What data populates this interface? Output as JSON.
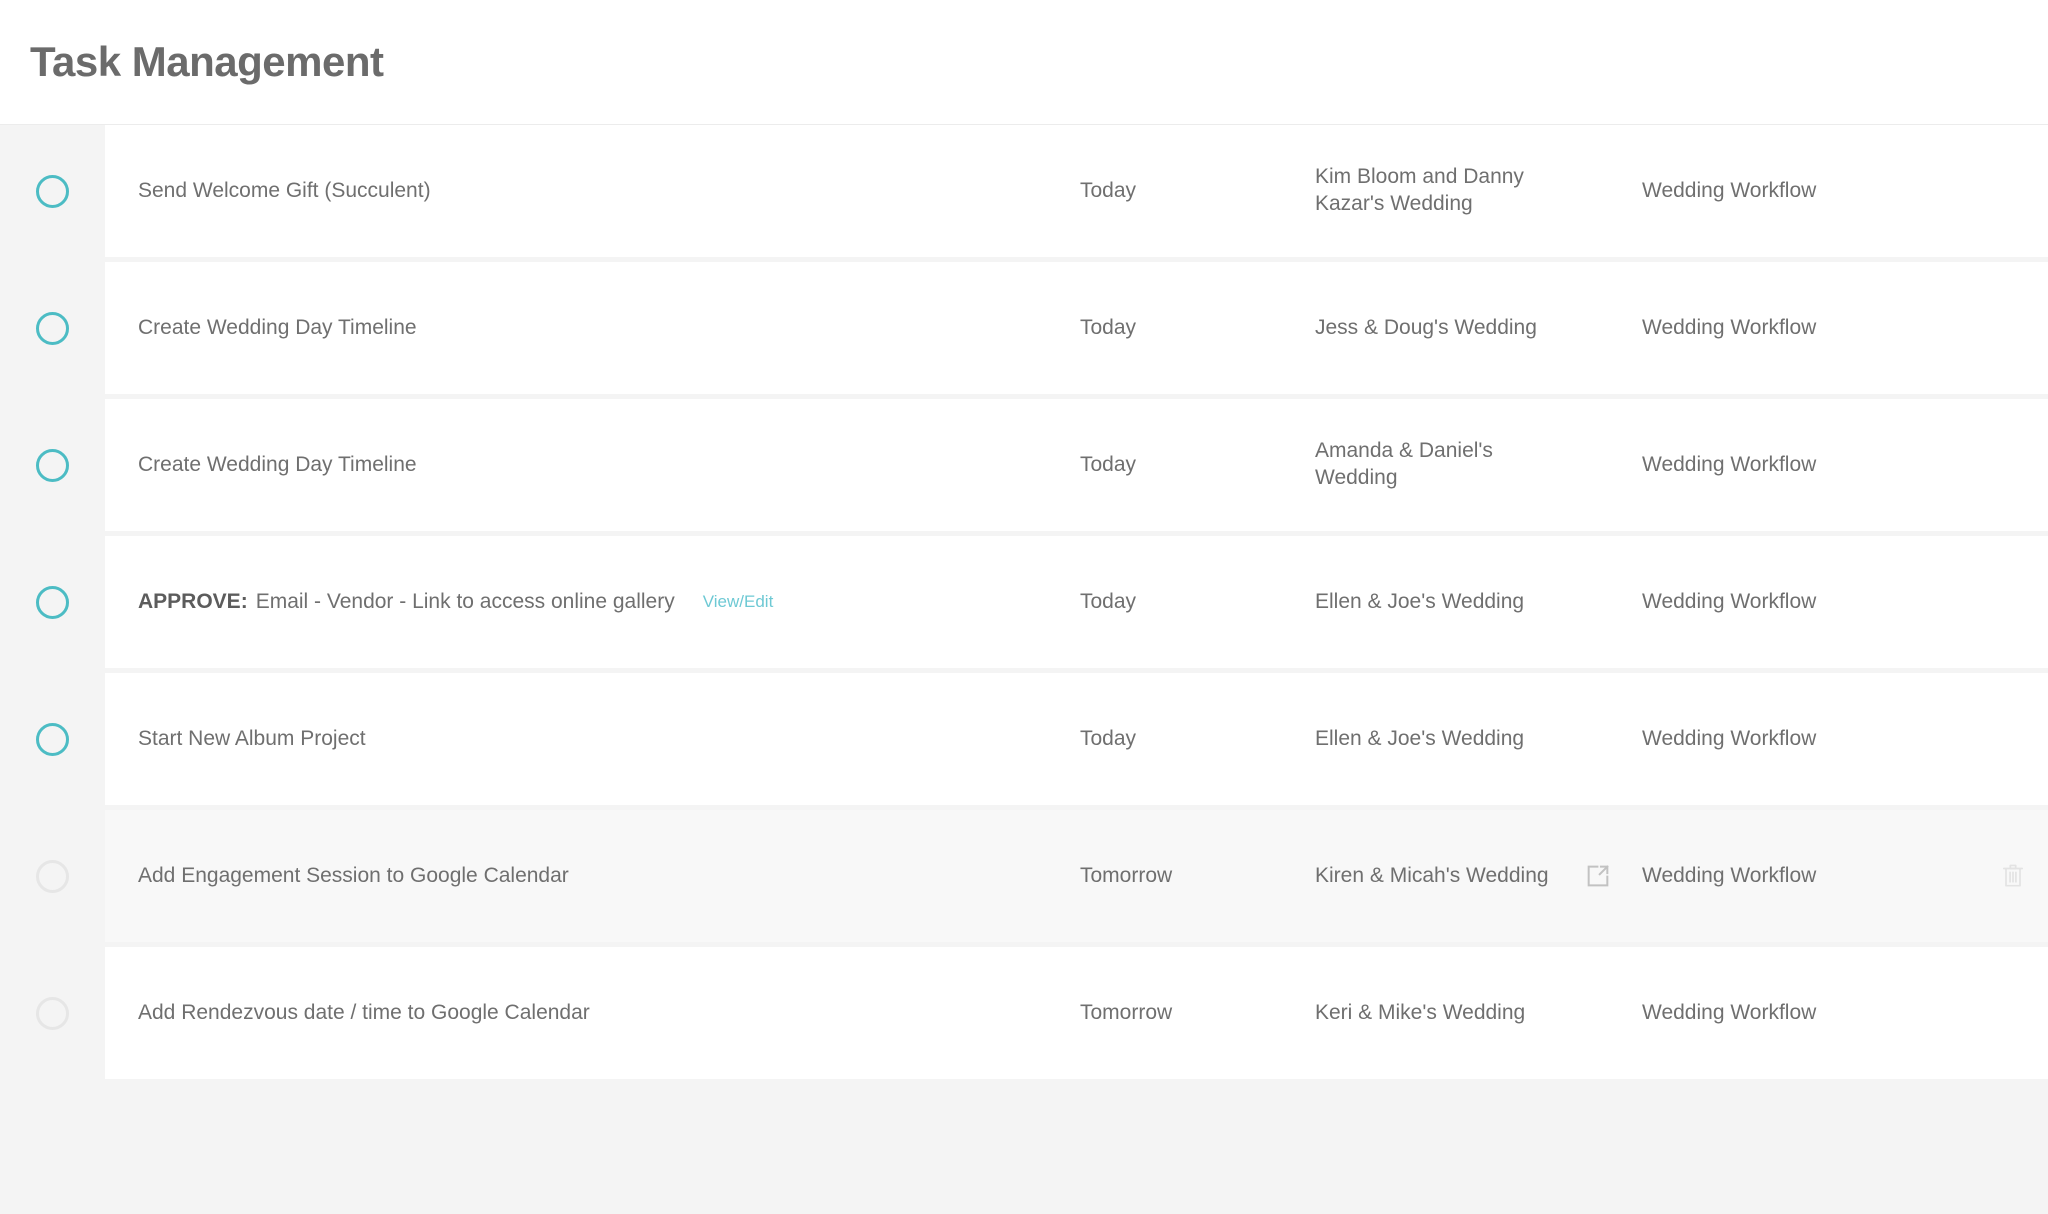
{
  "header": {
    "title": "Task Management"
  },
  "colors": {
    "accent_teal": "#4cbcc4",
    "link_teal": "#6ec9d4",
    "text_gray": "#6f6f6f",
    "title_gray": "#6b6b6b",
    "page_bg": "#f4f4f4",
    "card_bg": "#ffffff",
    "row_hover_bg": "#f8f8f8",
    "muted_circle": "#e6e6e6"
  },
  "icons": {
    "complete_toggle": "circle-outline-icon",
    "open_external": "external-link-icon",
    "delete": "trash-icon"
  },
  "tasks": [
    {
      "toggle_state": "active",
      "prefix": "",
      "label": "Send Welcome Gift (Succulent)",
      "link": "",
      "date": "Today",
      "client": "Kim Bloom and Danny Kazar's Wedding",
      "workflow": "Wedding Workflow",
      "hover": false,
      "show_icons": false
    },
    {
      "toggle_state": "active",
      "prefix": "",
      "label": "Create Wedding Day Timeline",
      "link": "",
      "date": "Today",
      "client": "Jess & Doug's Wedding",
      "workflow": "Wedding Workflow",
      "hover": false,
      "show_icons": false
    },
    {
      "toggle_state": "active",
      "prefix": "",
      "label": "Create Wedding Day Timeline",
      "link": "",
      "date": "Today",
      "client": "Amanda & Daniel's Wedding",
      "workflow": "Wedding Workflow",
      "hover": false,
      "show_icons": false
    },
    {
      "toggle_state": "active",
      "prefix": "APPROVE:",
      "label": "Email - Vendor - Link to access online gallery",
      "link": "View/Edit",
      "date": "Today",
      "client": "Ellen & Joe's Wedding",
      "workflow": "Wedding Workflow",
      "hover": false,
      "show_icons": false
    },
    {
      "toggle_state": "active",
      "prefix": "",
      "label": "Start New Album Project",
      "link": "",
      "date": "Today",
      "client": "Ellen & Joe's Wedding",
      "workflow": "Wedding Workflow",
      "hover": false,
      "show_icons": false
    },
    {
      "toggle_state": "muted",
      "prefix": "",
      "label": "Add Engagement Session to Google Calendar",
      "link": "",
      "date": "Tomorrow",
      "client": "Kiren & Micah's Wedding",
      "workflow": "Wedding Workflow",
      "hover": true,
      "show_icons": true
    },
    {
      "toggle_state": "muted",
      "prefix": "",
      "label": "Add Rendezvous date / time to Google Calendar",
      "link": "",
      "date": "Tomorrow",
      "client": "Keri & Mike's Wedding",
      "workflow": "Wedding Workflow",
      "hover": false,
      "show_icons": false
    }
  ]
}
